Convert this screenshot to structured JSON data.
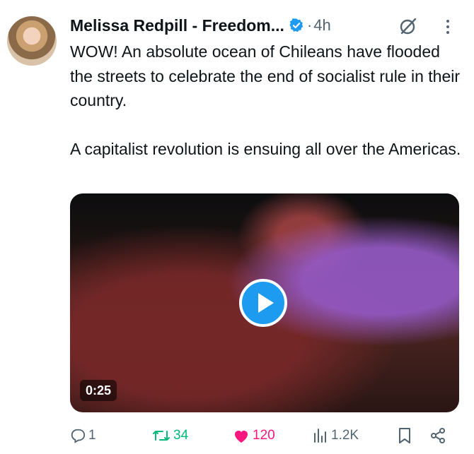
{
  "tweet": {
    "author_name": "Melissa Redpill - Freedom...",
    "separator": "·",
    "time": "4h",
    "body": [
      "WOW! An absolute ocean of Chileans have flooded the streets to celebrate the end of socialist rule in their country.",
      "A capitalist revolution is ensuing all over the Americas."
    ],
    "media": {
      "duration": "0:25"
    }
  },
  "actions": {
    "replies": "1",
    "reposts": "34",
    "likes": "120",
    "views": "1.2K"
  },
  "icons": {
    "verified": "verified-badge-icon",
    "grok": "grok-icon",
    "more": "more-options-icon",
    "reply": "reply-icon",
    "repost": "repost-icon",
    "like": "heart-icon",
    "views": "analytics-icon",
    "bookmark": "bookmark-icon",
    "share": "share-icon",
    "play": "play-icon"
  },
  "colors": {
    "accent": "#1d9bf0",
    "text": "#0f1419",
    "muted": "#536471",
    "repost": "#00ba7c",
    "like": "#f91880"
  }
}
